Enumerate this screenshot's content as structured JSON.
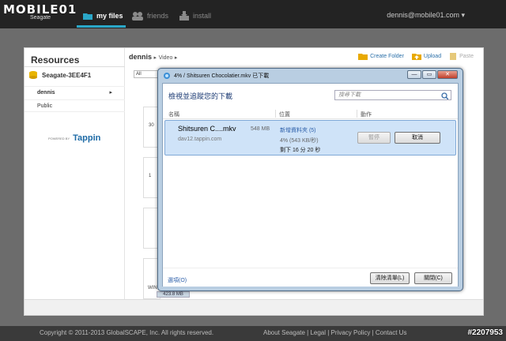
{
  "topbar": {
    "logo_text": "MOBILE01",
    "logo_sub": "Seagate",
    "nav": [
      {
        "label": "my files",
        "icon": "folder-icon"
      },
      {
        "label": "friends",
        "icon": "friends-icon"
      },
      {
        "label": "install",
        "icon": "install-icon"
      }
    ],
    "user": "dennis@mobile01.com",
    "accent_color": "#2aa7c8"
  },
  "sidebar": {
    "title": "Resources",
    "drive": "Seagate-3EE4F1",
    "items": [
      {
        "label": "dennis",
        "arrow": "▸"
      },
      {
        "label": "Public"
      }
    ],
    "powered_by": "POWERED BY",
    "tappin": "Tappin"
  },
  "main": {
    "breadcrumb_root": "dennis",
    "breadcrumb_sep": "▸",
    "breadcrumb_child": "Video",
    "filter_value": "All",
    "actions": {
      "create_folder": "Create Folder",
      "upload": "Upload",
      "paste": "Paste"
    },
    "tiles": [
      "30",
      "1",
      "",
      "",
      "WIN"
    ],
    "size_chip": "423.8 MB"
  },
  "dialog": {
    "title": "4% / Shitsuren Chocolatier.mkv 已下載",
    "controls": {
      "minimize": "—",
      "maximize": "▭",
      "close": "✕"
    },
    "heading": "檢視並追蹤您的下載",
    "search_placeholder": "搜尋下載",
    "columns": {
      "name": "名稱",
      "location": "位置",
      "action": "動作"
    },
    "download": {
      "name": "Shitsuren C....mkv",
      "size": "548 MB",
      "host": "dav12.tappin.com",
      "folder": "新增資料夾 (5)",
      "progress": "4% (543 KB/秒)",
      "progress_value": 0.04,
      "remaining": "剩下 16 分 20 秒",
      "pause_label": "暫停",
      "cancel_label": "取消"
    },
    "options_label": "選項(O)",
    "clear_label": "清除清單(L)",
    "close_label": "關閉(C)"
  },
  "footer": {
    "copyright": "Copyright © 2011-2013 GlobalSCAPE, Inc. All rights reserved.",
    "links": "About Seagate | Legal | Privacy Policy | Contact Us",
    "watermark": "#2207953"
  }
}
